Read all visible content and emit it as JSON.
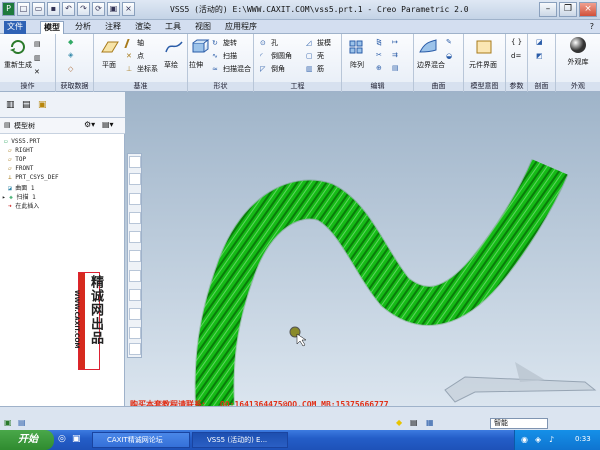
{
  "window": {
    "title": "VSS5 (活动的) E:\\WWW.CAXIT.COM\\vss5.prt.1 - Creo Parametric 2.0"
  },
  "tabs": [
    "文件",
    "模型",
    "分析",
    "注释",
    "渲染",
    "工具",
    "视图",
    "应用程序"
  ],
  "active_tab": "模型",
  "ribbon": {
    "groups": [
      {
        "label": "操作",
        "buttons": [
          "重新生成"
        ]
      },
      {
        "label": "获取数据",
        "buttons": []
      },
      {
        "label": "基准",
        "buttons": [
          "平面",
          "轴",
          "点",
          "坐标系",
          "草绘"
        ]
      },
      {
        "label": "形状",
        "buttons": [
          "旋转",
          "扫描",
          "扫描混合"
        ]
      },
      {
        "label": "工程",
        "buttons": [
          "孔",
          "倒圆角",
          "倒角",
          "拔模",
          "壳",
          "筋"
        ]
      },
      {
        "label": "编辑",
        "buttons": [
          "阵列"
        ]
      },
      {
        "label": "曲面",
        "buttons": [
          "边界混合"
        ]
      },
      {
        "label": "模型意图",
        "buttons": [
          "元件界面"
        ]
      },
      {
        "label": "参数",
        "buttons": []
      },
      {
        "label": "剖面",
        "buttons": []
      },
      {
        "label": "外观",
        "buttons": [
          "外观库"
        ]
      }
    ]
  },
  "model_tree": {
    "header": "模型树",
    "nodes": [
      "VSS5.PRT",
      "RIGHT",
      "TOP",
      "FRONT",
      "PRT_CSYS_DEF",
      "曲面 1",
      "扫描 1",
      "在此插入"
    ]
  },
  "brand": {
    "text": "精诚网出品",
    "url": "WWW.CAXIT.COM"
  },
  "overlay": {
    "buy_text": "购买本套教程请联系:",
    "contact": "QQ:1641364475@QQ.COM MB:15375666777"
  },
  "status": {
    "filter_value": "智能"
  },
  "taskbar": {
    "start": "开始",
    "tasks": [
      "CAXIT精诚网论坛",
      "VSS5 (活动的) E..."
    ],
    "clock": "0:33"
  },
  "colors": {
    "rope": "#19d11a",
    "rope_dark": "#0a7d0a",
    "brand_red": "#d62a1e",
    "overlay_red": "#e03018",
    "taskbar_blue": "#245ec8"
  }
}
